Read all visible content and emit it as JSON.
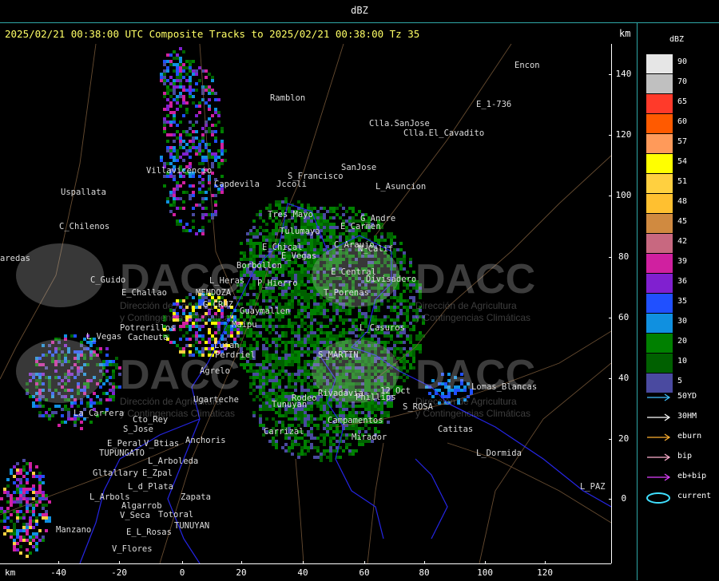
{
  "window": {
    "title": "dBZ"
  },
  "header": {
    "text": "2025/02/21 00:38:00 UTC Composite Tracks to 2025/02/21 00:38:00 Tz 35",
    "units_top": "km",
    "units_bottom": "km"
  },
  "axes": {
    "x_ticks": [
      "-40",
      "-20",
      "0",
      "20",
      "40",
      "60",
      "80",
      "100",
      "120"
    ],
    "y_ticks": [
      "140",
      "120",
      "100",
      "80",
      "60",
      "40",
      "20",
      "0"
    ]
  },
  "places": [
    "Ramblon",
    "Encon",
    "E_1-736",
    "Clla.SanJose",
    "Clla.El_Cavadito",
    "S_Francisco",
    "SanJose",
    "Villavicencio",
    "Uspallata",
    "Jccoli",
    "Capdevila",
    "L_Asuncion",
    "Tres_Mayo",
    "G_Andre",
    "C_Chilenos",
    "E_Carmen",
    "Tulumaya",
    "C_Araujo",
    "E_Chical",
    "N_Calif",
    "E_Vegas",
    "E_Central",
    "Borbollon",
    "Divisadero",
    "C_Guido",
    "L_Heras",
    "P_Hierro",
    "MENDOZA",
    "E_Challao",
    "T_Porenas",
    "G_CRUZ",
    "Guaymallen",
    "Maipu",
    "Potrerillos",
    "Cacheuta",
    "L_Vegas",
    "L_Casuros",
    "Perdriel",
    "Lujan",
    "S_MARTIN",
    "Agrelo",
    "Rodeo",
    "Ugarteche",
    "Tunuyan",
    "Rivadavia",
    "Phillips",
    "12_Oct",
    "Lomas_Blancas",
    "La_Carrera",
    "Cto_Rey",
    "S_Jose",
    "Carrizal",
    "E_Peral",
    "V_Btias",
    "Anchoris",
    "Mirador",
    "Catitas",
    "S_ROSA",
    "Campamentos",
    "TUPUNGATO",
    "L_Arboleda",
    "L_Dormida",
    "Gltallary",
    "E_Zpal",
    "L_d_Plata",
    "L_PAZ",
    "L_Arbols",
    "Zapata",
    "Algarrob",
    "V_Seca",
    "Totoral",
    "Manzano",
    "E_L_Rosas",
    "TUNUYAN",
    "V_Flores",
    "aredas"
  ],
  "watermarks": [
    {
      "brand": "DACC",
      "line1": "Dirección de Agricultura",
      "line2": "y Contingencias Climáticas"
    }
  ],
  "legend": {
    "title": "dBZ",
    "scale": [
      {
        "label": "90",
        "color": "#e6e6e6"
      },
      {
        "label": "70",
        "color": "#c0c0c0"
      },
      {
        "label": "65",
        "color": "#ff3a2a"
      },
      {
        "label": "60",
        "color": "#ff5a00"
      },
      {
        "label": "57",
        "color": "#ff9a5a"
      },
      {
        "label": "54",
        "color": "#ffff00"
      },
      {
        "label": "51",
        "color": "#ffd040"
      },
      {
        "label": "48",
        "color": "#ffc030"
      },
      {
        "label": "45",
        "color": "#d08a40"
      },
      {
        "label": "42",
        "color": "#c86880"
      },
      {
        "label": "39",
        "color": "#d020a0"
      },
      {
        "label": "36",
        "color": "#8020d0"
      },
      {
        "label": "35",
        "color": "#2050ff"
      },
      {
        "label": "30",
        "color": "#1090e0"
      },
      {
        "label": "20",
        "color": "#008000"
      },
      {
        "label": "10",
        "color": "#006000"
      },
      {
        "label": "5",
        "color": "#4a4aa0"
      }
    ],
    "tracks": [
      {
        "label": "50YD",
        "color": "#40c0ff"
      },
      {
        "label": "30HM",
        "color": "#ffffff"
      },
      {
        "label": "eburn",
        "color": "#ffb030"
      },
      {
        "label": "bip",
        "color": "#ffb0d0"
      },
      {
        "label": "eb+bip",
        "color": "#e040ff"
      },
      {
        "label": "current",
        "color": "#40e0ff"
      }
    ]
  }
}
